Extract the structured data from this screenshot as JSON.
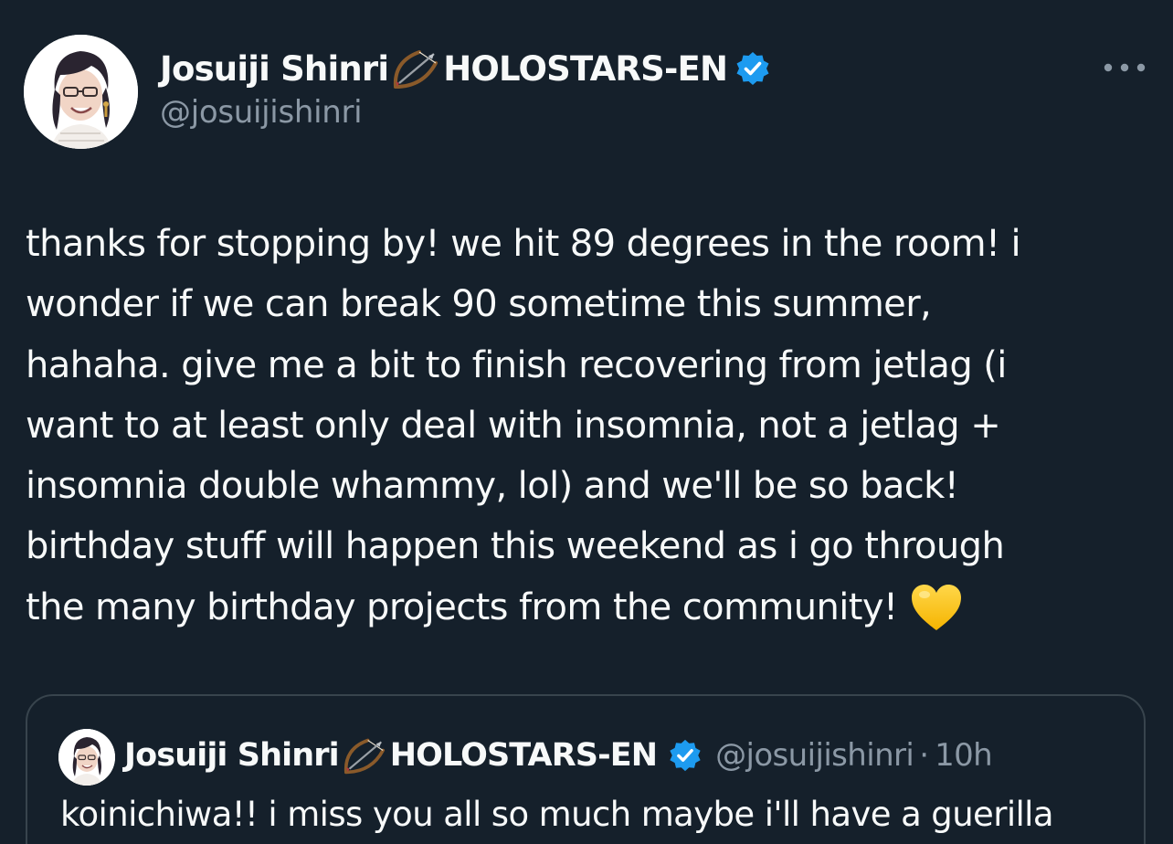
{
  "author": {
    "display_name": "Josuiji Shinri",
    "name_suffix": "HOLOSTARS-EN",
    "handle": "@josuijishinri",
    "verified": true
  },
  "tweet": {
    "lines": [
      "thanks for stopping by! we hit 89 degrees in the room! i",
      "wonder if we can break 90 sometime this summer,",
      "hahaha. give me a bit to finish recovering from jetlag (i",
      "want to at least only deal with insomnia, not a jetlag +",
      "insomnia double whammy, lol) and we'll be so back!",
      "birthday stuff will happen this weekend as i go through",
      "the many birthday projects from the community!"
    ],
    "trailing_emoji": "yellow-heart-icon"
  },
  "quoted_tweet": {
    "display_name": "Josuiji Shinri",
    "name_suffix": "HOLOSTARS-EN",
    "handle": "@josuijishinri",
    "separator": "·",
    "time": "10h",
    "text": "koinichiwa!! i miss you all so much maybe i'll have a guerilla"
  },
  "icons": {
    "name_emoji": "bow-and-arrow-icon",
    "verified": "verified-badge-icon",
    "more": "more-options-icon"
  },
  "colors": {
    "background": "#15202b",
    "text_primary": "#f7f9f9",
    "text_secondary": "#8b98a5",
    "verified_blue": "#1d9bf0",
    "border": "#38444d",
    "heart": "#ffcc33"
  }
}
